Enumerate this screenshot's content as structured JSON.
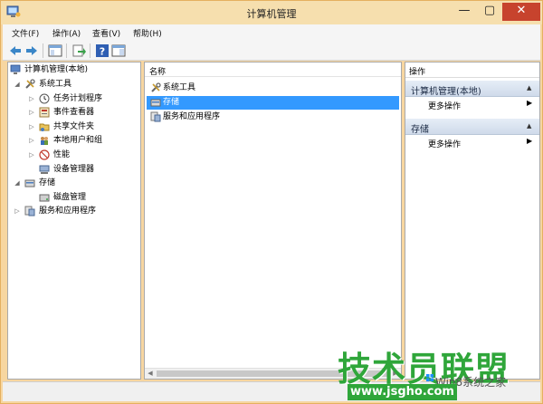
{
  "window": {
    "title": "计算机管理",
    "controls": {
      "minimize": "—",
      "maximize": "▢",
      "close": "✕"
    }
  },
  "menu": [
    {
      "label": "文件(F)"
    },
    {
      "label": "操作(A)"
    },
    {
      "label": "查看(V)"
    },
    {
      "label": "帮助(H)"
    }
  ],
  "toolbar": {
    "icons": [
      "back-arrow-icon",
      "forward-arrow-icon",
      "show-console-tree-icon",
      "export-list-icon",
      "help-icon",
      "show-action-pane-icon"
    ]
  },
  "tree": {
    "root": "计算机管理(本地)",
    "items": [
      {
        "label": "系统工具"
      },
      {
        "label": "任务计划程序"
      },
      {
        "label": "事件查看器"
      },
      {
        "label": "共享文件夹"
      },
      {
        "label": "本地用户和组"
      },
      {
        "label": "性能"
      },
      {
        "label": "设备管理器"
      },
      {
        "label": "存储"
      },
      {
        "label": "磁盘管理"
      },
      {
        "label": "服务和应用程序"
      }
    ]
  },
  "list": {
    "header": "名称",
    "rows": [
      {
        "label": "系统工具",
        "selected": false
      },
      {
        "label": "存储",
        "selected": true
      },
      {
        "label": "服务和应用程序",
        "selected": false
      }
    ]
  },
  "actions": {
    "header": "操作",
    "groups": [
      {
        "title": "计算机管理(本地)",
        "items": [
          "更多操作"
        ]
      },
      {
        "title": "存储",
        "items": [
          "更多操作"
        ]
      }
    ]
  },
  "watermark": {
    "main": "技术员联盟",
    "sub": "www.jsgho.com",
    "win": "Win8系统之家"
  },
  "colors": {
    "selection": "#3399ff",
    "close_button": "#c7432d",
    "watermark_green": "#2fa63a",
    "action_group": "#cfdaea"
  }
}
